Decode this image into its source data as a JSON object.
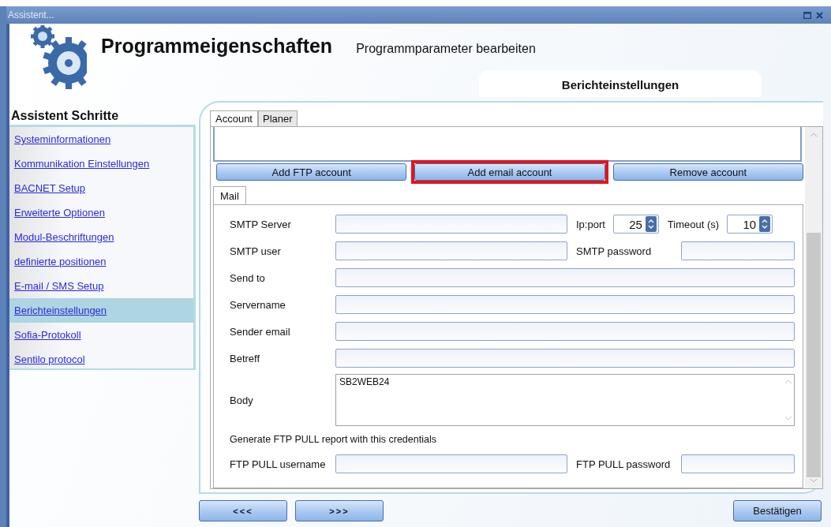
{
  "window": {
    "title": "Assistent..."
  },
  "header": {
    "title": "Programmeigenschaften",
    "subtitle": "Programmparameter bearbeiten",
    "section": "Berichteinstellungen"
  },
  "sidebar": {
    "heading": "Assistent Schritte",
    "items": [
      {
        "label": "Systeminformationen",
        "selected": false
      },
      {
        "label": "Kommunikation Einstellungen",
        "selected": false
      },
      {
        "label": "BACNET Setup",
        "selected": false
      },
      {
        "label": "Erweiterte Optionen",
        "selected": false
      },
      {
        "label": "Modul-Beschriftungen",
        "selected": false
      },
      {
        "label": "definierte positionen",
        "selected": false
      },
      {
        "label": "E-mail / SMS Setup",
        "selected": false
      },
      {
        "label": "Berichteinstellungen",
        "selected": true
      },
      {
        "label": "Sofia-Protokoll",
        "selected": false
      },
      {
        "label": "Sentilo protocol",
        "selected": false
      }
    ]
  },
  "tabs": [
    {
      "label": "Account",
      "selected": true
    },
    {
      "label": "Planer",
      "selected": false
    }
  ],
  "account_buttons": [
    {
      "label": "Add FTP account",
      "highlighted": false
    },
    {
      "label": "Add email account",
      "highlighted": true
    },
    {
      "label": "Remove account",
      "highlighted": false
    }
  ],
  "inner_tabs": [
    {
      "label": "Mail",
      "selected": true
    }
  ],
  "form": [
    {
      "kind": "text",
      "label": "SMTP Server",
      "extras": [
        {
          "kind": "spinner",
          "label": "Ip:port",
          "value": "25"
        },
        {
          "kind": "spinner",
          "label": "Timeout (s)",
          "value": "10"
        }
      ]
    },
    {
      "kind": "text",
      "label": "SMTP user",
      "extras": [
        {
          "kind": "text",
          "label": "SMTP password"
        }
      ]
    },
    {
      "kind": "text",
      "label": "Send to"
    },
    {
      "kind": "text",
      "label": "Servername"
    },
    {
      "kind": "text",
      "label": "Sender email"
    },
    {
      "kind": "text",
      "label": "Betreff"
    },
    {
      "kind": "textarea",
      "label": "Body",
      "value": "SB2WEB24"
    },
    {
      "kind": "note",
      "label": "Generate FTP PULL report with this credentials"
    },
    {
      "kind": "text",
      "label": "FTP PULL username",
      "extras": [
        {
          "kind": "text",
          "label": "FTP PULL password"
        }
      ]
    }
  ],
  "nav_buttons": [
    "<<<",
    ">>>"
  ],
  "confirm_button": "Bestätigen"
}
